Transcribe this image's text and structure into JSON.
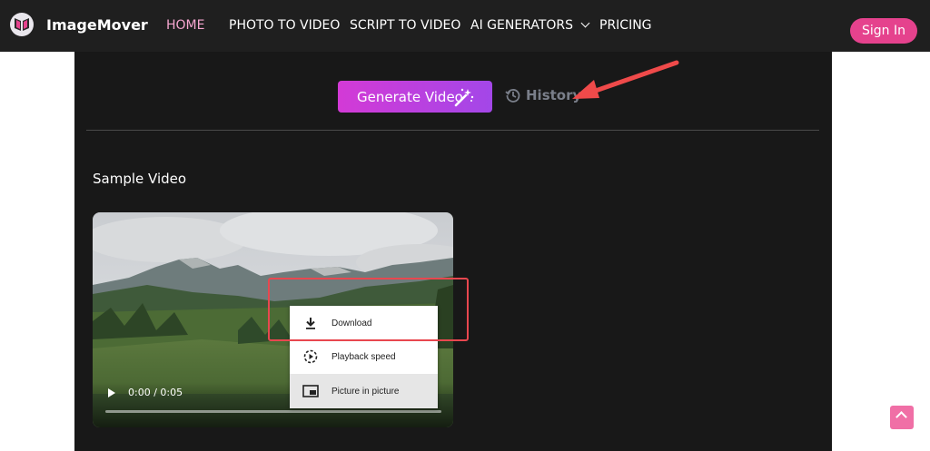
{
  "header": {
    "brand": "ImageMover",
    "nav": [
      {
        "label": "HOME",
        "active": true
      },
      {
        "label": "PHOTO TO VIDEO"
      },
      {
        "label": "SCRIPT TO VIDEO"
      },
      {
        "label": "AI GENERATORS",
        "dropdown": true
      },
      {
        "label": "PRICING"
      }
    ],
    "sign_in": "Sign In"
  },
  "toolbar": {
    "generate_label": "Generate Video",
    "history_label": "History"
  },
  "sample": {
    "title": "Sample Video",
    "time": "0:00 / 0:05",
    "progress": 0
  },
  "context_menu": {
    "items": [
      {
        "label": "Download",
        "icon": "download-icon"
      },
      {
        "label": "Playback speed",
        "icon": "playback-speed-icon"
      },
      {
        "label": "Picture in picture",
        "icon": "picture-in-picture-icon",
        "highlighted": true
      }
    ]
  },
  "colors": {
    "accent": "#e5428d",
    "annotation": "#e8474f",
    "active_nav": "#f7a6d0"
  }
}
